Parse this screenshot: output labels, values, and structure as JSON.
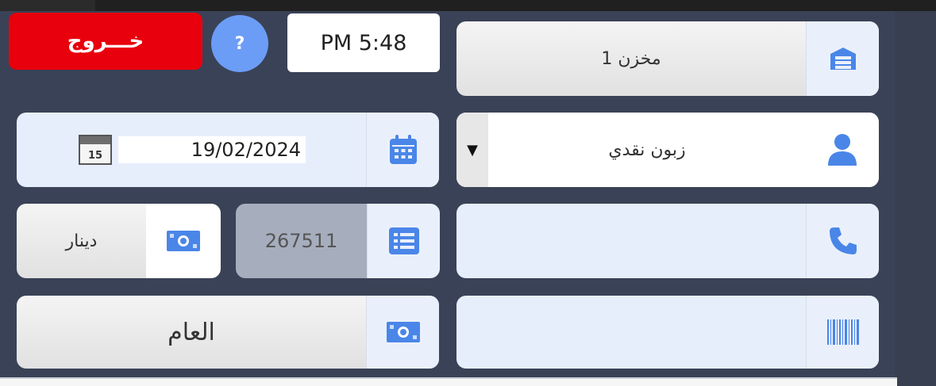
{
  "exit_label": "خـــروج",
  "help_label": "?",
  "time": "PM 5:48",
  "warehouse": {
    "value": "مخزن 1",
    "icon": "warehouse-icon"
  },
  "customer": {
    "value": "زبون نقدي",
    "dropdown_arrow": "▼",
    "icon": "user-icon"
  },
  "date": {
    "value": "19/02/2024",
    "picker_day": "15",
    "icon": "calendar-icon"
  },
  "phone": {
    "value": "",
    "icon": "phone-icon"
  },
  "invoice_number": {
    "value": "267511",
    "icon": "list-icon"
  },
  "currency": {
    "value": "دينار",
    "icon": "money-icon"
  },
  "barcode": {
    "value": "",
    "icon": "barcode-icon"
  },
  "cashbox": {
    "value": "العام",
    "icon": "money-icon"
  },
  "colors": {
    "accent": "#4a86e8",
    "exit": "#e8000c",
    "background": "#3a4257",
    "help": "#6b9df6"
  }
}
